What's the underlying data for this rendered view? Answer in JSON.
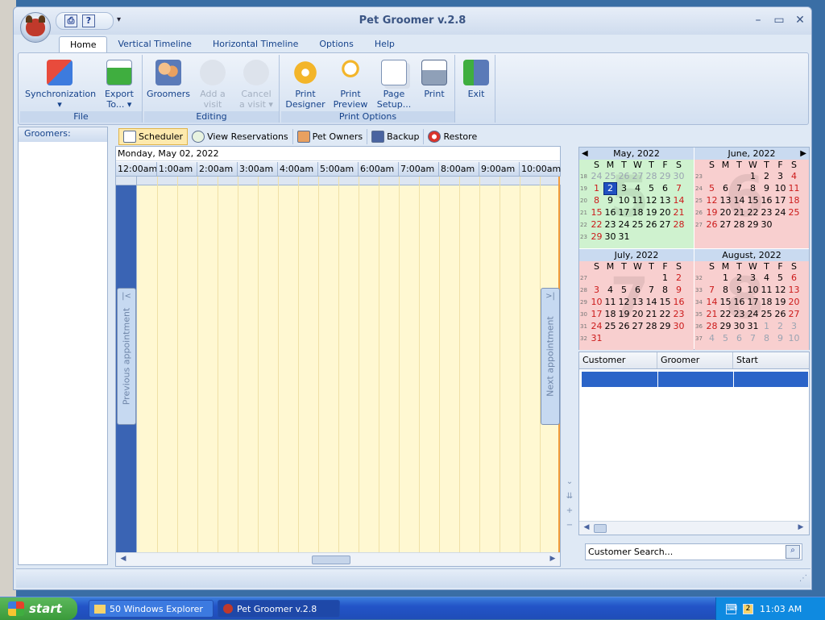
{
  "app": {
    "title": "Pet Groomer v.2.8"
  },
  "qat": {
    "print_icon": "printer-icon",
    "help_icon": "help-icon"
  },
  "window_controls": {
    "minimize": "–",
    "restore": "▭",
    "close": "✕"
  },
  "ribbon_tabs": [
    "Home",
    "Vertical Timeline",
    "Horizontal Timeline",
    "Options",
    "Help"
  ],
  "ribbon": {
    "file_label": "File",
    "editing_label": "Editing",
    "print_label": "Print Options",
    "sync": [
      "Synchronization",
      "▾"
    ],
    "export": [
      "Export",
      "To... ▾"
    ],
    "groomers": [
      "Groomers",
      ""
    ],
    "add_visit": [
      "Add a",
      "visit"
    ],
    "cancel_visit": [
      "Cancel",
      "a visit ▾"
    ],
    "print_designer": [
      "Print",
      "Designer"
    ],
    "print_preview": [
      "Print",
      "Preview"
    ],
    "page_setup": [
      "Page",
      "Setup..."
    ],
    "print": [
      "Print",
      ""
    ],
    "exit": [
      "Exit",
      ""
    ]
  },
  "left_panel": {
    "header": "Groomers:"
  },
  "sub_tabs": [
    "Scheduler",
    "View Reservations",
    "Pet Owners",
    "Backup",
    "Restore"
  ],
  "scheduler": {
    "date": "Monday, May 02, 2022",
    "times": [
      "12:00am",
      "1:00am",
      "2:00am",
      "3:00am",
      "4:00am",
      "5:00am",
      "6:00am",
      "7:00am",
      "8:00am",
      "9:00am",
      "10:00am"
    ],
    "prev": "Previous appointment",
    "next": "Next appointment"
  },
  "calendar": {
    "dow": [
      "S",
      "M",
      "T",
      "W",
      "T",
      "F",
      "S"
    ],
    "months": [
      {
        "title": "May, 2022",
        "bg": "#cff2cf",
        "big": "5",
        "weeks": [
          [
            "18",
            "24o",
            "25o",
            "26o",
            "27o",
            "28o",
            "29o",
            "30o"
          ],
          [
            "19",
            "1",
            "2s",
            "3",
            "4",
            "5",
            "6",
            "7"
          ],
          [
            "20",
            "8",
            "9",
            "10",
            "11",
            "12",
            "13",
            "14"
          ],
          [
            "21",
            "15",
            "16",
            "17",
            "18",
            "19",
            "20",
            "21"
          ],
          [
            "22",
            "22",
            "23",
            "24",
            "25",
            "26",
            "27",
            "28"
          ],
          [
            "23",
            "29",
            "30",
            "31",
            "",
            "",
            "",
            ""
          ]
        ]
      },
      {
        "title": "June, 2022",
        "bg": "#f8cfcf",
        "big": "6",
        "weeks": [
          [
            "23",
            "",
            "",
            "",
            "1",
            "2",
            "3",
            "4"
          ],
          [
            "24",
            "5",
            "6",
            "7",
            "8",
            "9",
            "10",
            "11"
          ],
          [
            "25",
            "12",
            "13",
            "14",
            "15",
            "16",
            "17",
            "18"
          ],
          [
            "26",
            "19",
            "20",
            "21",
            "22",
            "23",
            "24",
            "25"
          ],
          [
            "27",
            "26",
            "27",
            "28",
            "29",
            "30",
            "",
            ""
          ]
        ]
      },
      {
        "title": "July, 2022",
        "bg": "#f8cfcf",
        "big": "7",
        "weeks": [
          [
            "27",
            "",
            "",
            "",
            "",
            "",
            "1",
            "2"
          ],
          [
            "28",
            "3",
            "4",
            "5",
            "6",
            "7",
            "8",
            "9"
          ],
          [
            "29",
            "10",
            "11",
            "12",
            "13",
            "14",
            "15",
            "16"
          ],
          [
            "30",
            "17",
            "18",
            "19",
            "20",
            "21",
            "22",
            "23"
          ],
          [
            "31",
            "24",
            "25",
            "26",
            "27",
            "28",
            "29",
            "30"
          ],
          [
            "32",
            "31",
            "",
            "",
            "",
            "",
            "",
            ""
          ]
        ]
      },
      {
        "title": "August, 2022",
        "bg": "#f8cfcf",
        "big": "8",
        "weeks": [
          [
            "32",
            "",
            "1",
            "2",
            "3",
            "4",
            "5",
            "6"
          ],
          [
            "33",
            "7",
            "8",
            "9",
            "10",
            "11",
            "12",
            "13"
          ],
          [
            "34",
            "14",
            "15",
            "16",
            "17",
            "18",
            "19",
            "20"
          ],
          [
            "35",
            "21",
            "22",
            "23",
            "24",
            "25",
            "26",
            "27"
          ],
          [
            "36",
            "28",
            "29",
            "30",
            "31",
            "1o",
            "2o",
            "3o"
          ],
          [
            "37",
            "4o",
            "5o",
            "6o",
            "7o",
            "8o",
            "9o",
            "10o"
          ]
        ]
      }
    ]
  },
  "grid": {
    "columns": [
      "Customer",
      "Groomer",
      "Start"
    ]
  },
  "search": {
    "placeholder": "Customer Search..."
  },
  "taskbar": {
    "start": "start",
    "items": [
      "50 Windows Explorer",
      "Pet Groomer v.2.8"
    ],
    "tray_badge": "2",
    "clock": "11:03 AM"
  }
}
